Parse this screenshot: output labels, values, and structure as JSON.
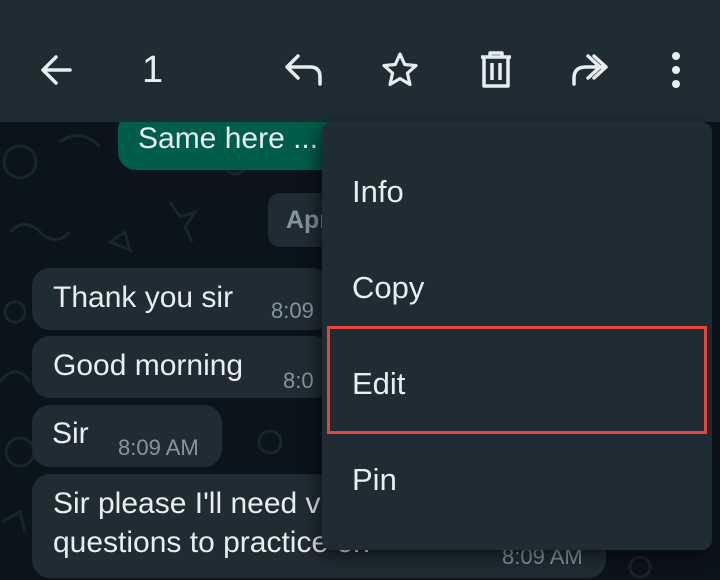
{
  "toolbar": {
    "selected_count": "1",
    "icons": [
      "back-arrow-icon",
      "reply-icon",
      "star-icon",
      "delete-icon",
      "forward-icon",
      "more-vert-icon"
    ]
  },
  "messages": [
    {
      "text": "Same here ...",
      "direction": "outgoing"
    },
    {
      "text": "Thank you sir",
      "time": "8:09",
      "direction": "incoming"
    },
    {
      "text": "Good morning",
      "time": "8:0",
      "direction": "incoming"
    },
    {
      "text": "Sir",
      "time": "8:09 AM",
      "direction": "incoming"
    },
    {
      "text_line1": "Sir please I'll need v",
      "text_line2": "questions to practice on",
      "time": "8:09 AM",
      "direction": "incoming"
    }
  ],
  "date_divider": "Apr",
  "context_menu": {
    "items": [
      "Info",
      "Copy",
      "Edit",
      "Pin"
    ],
    "highlighted": "Edit"
  },
  "colors": {
    "header": "#1f2c34",
    "background": "#0b141a",
    "incoming_bubble": "#202c33",
    "outgoing_bubble": "#005c4b",
    "highlight_box": "#e8433b"
  }
}
